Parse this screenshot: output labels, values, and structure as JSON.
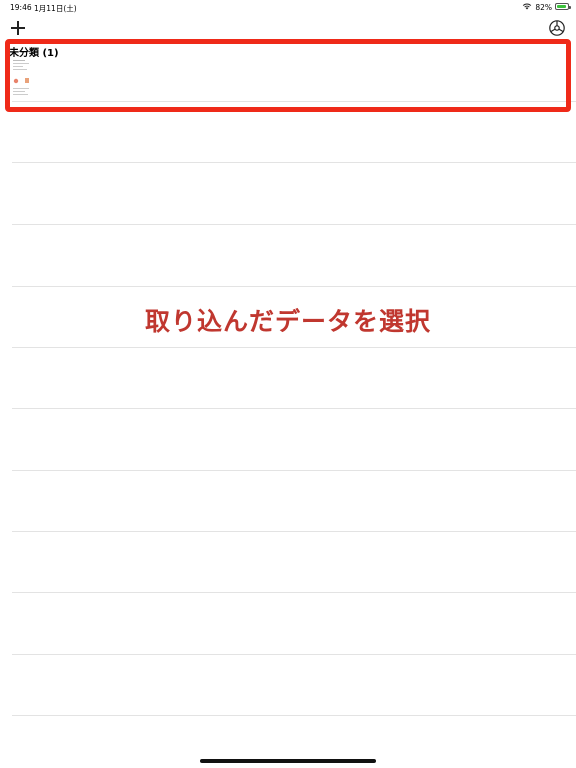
{
  "status_bar": {
    "time": "19:46",
    "date": "1月11日(土)",
    "battery_percent": "82%",
    "battery_level": 0.82,
    "battery_color": "#3cc23c"
  },
  "nav": {
    "add_icon": "plus-icon",
    "settings_icon": "gear-icon"
  },
  "list": {
    "first_item_title": "未分類 (1)"
  },
  "annotation": {
    "text": "取り込んだデータを選択",
    "text_color": "#c0372f",
    "highlight_color": "#ef2a19"
  }
}
